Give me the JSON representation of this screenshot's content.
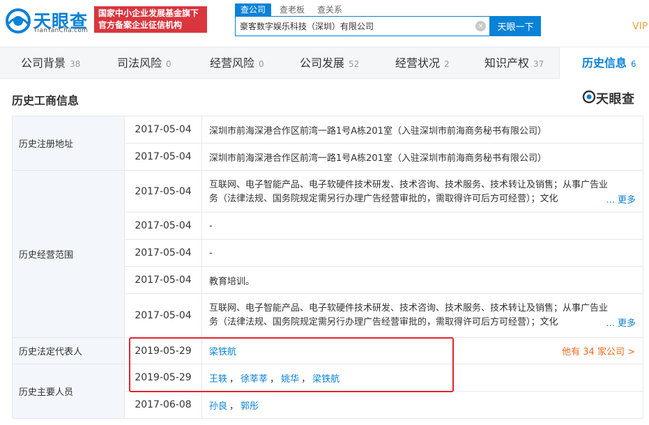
{
  "header": {
    "logo_text": "天眼查",
    "logo_sub": "TianYanCha.com",
    "badge_line1": "国家中小企业发展基金旗下",
    "badge_line2": "官方备案企业征信机构",
    "search_tabs": [
      "查公司",
      "查老板",
      "查关系"
    ],
    "search_value": "豪客数字娱乐科技（深圳）有限公司",
    "clear_glyph": "×",
    "search_button": "天眼一下",
    "vip": "VIP"
  },
  "nav": {
    "tabs": [
      {
        "label": "公司背景",
        "count": "38"
      },
      {
        "label": "司法风险",
        "count": "0"
      },
      {
        "label": "经营风险",
        "count": "0"
      },
      {
        "label": "公司发展",
        "count": "52"
      },
      {
        "label": "经营状况",
        "count": "2"
      },
      {
        "label": "知识产权",
        "count": "37"
      },
      {
        "label": "历史信息",
        "count": "6"
      }
    ]
  },
  "section": {
    "title": "历史工商信息",
    "brand": "天眼查"
  },
  "table": {
    "more_label": "... 更多",
    "address": {
      "label": "历史注册地址",
      "rows": [
        {
          "date": "2017-05-04",
          "value": "深圳市前海深港合作区前湾一路1号A栋201室（入驻深圳市前海商务秘书有限公司）"
        },
        {
          "date": "2017-05-04",
          "value": "深圳市前海深港合作区前湾一路1号A栋201室（入驻深圳市前海商务秘书有限公司）"
        }
      ]
    },
    "scope": {
      "label": "历史经营范围",
      "rows": [
        {
          "date": "2017-05-04",
          "value": "互联网、电子智能产品、电子软硬件技术研发、技术咨询、技术服务、技术转让及销售；从事广告业务（法律法规、国务院规定需另行办理广告经营审批的，需取得许可后方可经营）；文化"
        },
        {
          "date": "2017-05-04",
          "value": "-"
        },
        {
          "date": "2017-05-04",
          "value": "-"
        },
        {
          "date": "2017-05-04",
          "value": "教育培训。"
        },
        {
          "date": "2017-05-04",
          "value": "互联网、电子智能产品、电子软硬件技术研发、技术咨询、技术服务、技术转让及销售；从事广告业务（法律法规、国务院规定需另行办理广告经营审批的，需取得许可后方可经营）；文化"
        }
      ]
    },
    "legal_rep": {
      "label": "历史法定代表人",
      "date": "2019-05-29",
      "name": "梁铁航",
      "other": "他有 34 家公司 >"
    },
    "personnel": {
      "label": "历史主要人员",
      "rows": [
        {
          "date": "2019-05-29",
          "names": [
            "王轶",
            "徐莘莘",
            "姚华",
            "梁铁航"
          ]
        },
        {
          "date": "2017-06-08",
          "names": [
            "孙良",
            "郭彤"
          ]
        }
      ]
    },
    "separator": "，"
  }
}
